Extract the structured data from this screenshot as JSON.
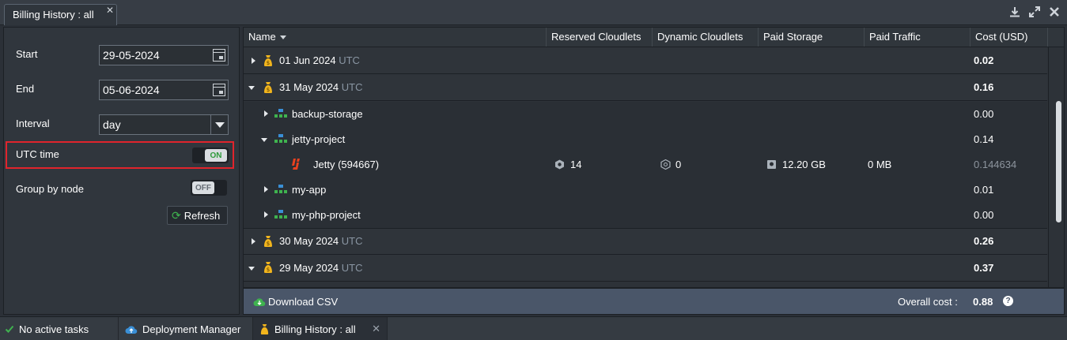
{
  "window": {
    "tab_title": "Billing History : all",
    "tab_close": "✕",
    "tools": [
      "download-icon",
      "expand-icon",
      "close-icon"
    ]
  },
  "filters": {
    "start_label": "Start",
    "start_value": "29-05-2024",
    "end_label": "End",
    "end_value": "05-06-2024",
    "interval_label": "Interval",
    "interval_value": "day",
    "utc_label": "UTC time",
    "utc_toggle": "ON",
    "group_label": "Group by node",
    "group_toggle": "OFF",
    "refresh_label": "Refresh"
  },
  "grid": {
    "columns": [
      "Name",
      "Reserved Cloudlets",
      "Dynamic Cloudlets",
      "Paid Storage",
      "Paid Traffic",
      "Cost (USD)"
    ],
    "rows": [
      {
        "type": "date",
        "name": "01 Jun 2024",
        "tz": "UTC",
        "cost": "0.02",
        "expanded": false
      },
      {
        "type": "date",
        "name": "31 May 2024",
        "tz": "UTC",
        "cost": "0.16",
        "expanded": true
      },
      {
        "type": "env",
        "name": "backup-storage",
        "cost": "0.00",
        "expanded": false
      },
      {
        "type": "env",
        "name": "jetty-project",
        "cost": "0.14",
        "expanded": true
      },
      {
        "type": "node",
        "name": "Jetty (594667)",
        "reserved": "14",
        "dynamic": "0",
        "storage": "12.20 GB",
        "traffic": "0 MB",
        "cost": "0.144634"
      },
      {
        "type": "env",
        "name": "my-app",
        "cost": "0.01",
        "expanded": false
      },
      {
        "type": "env",
        "name": "my-php-project",
        "cost": "0.00",
        "expanded": false
      },
      {
        "type": "date",
        "name": "30 May 2024",
        "tz": "UTC",
        "cost": "0.26",
        "expanded": false
      },
      {
        "type": "date",
        "name": "29 May 2024",
        "tz": "UTC",
        "cost": "0.37",
        "expanded": true
      }
    ]
  },
  "footer": {
    "download_label": "Download CSV",
    "overall_label": "Overall cost :",
    "overall_value": "0.88",
    "help": "?"
  },
  "taskbar": {
    "items": [
      "No active tasks",
      "Deployment Manager",
      "Billing History : all"
    ],
    "close": "✕"
  },
  "colors": {
    "accent_green": "#3fb34f",
    "highlight_red": "#e0242c",
    "moneybag": "#f2b51d",
    "env_blue": "#3a8fd6",
    "footer_bg": "#4a5669"
  }
}
